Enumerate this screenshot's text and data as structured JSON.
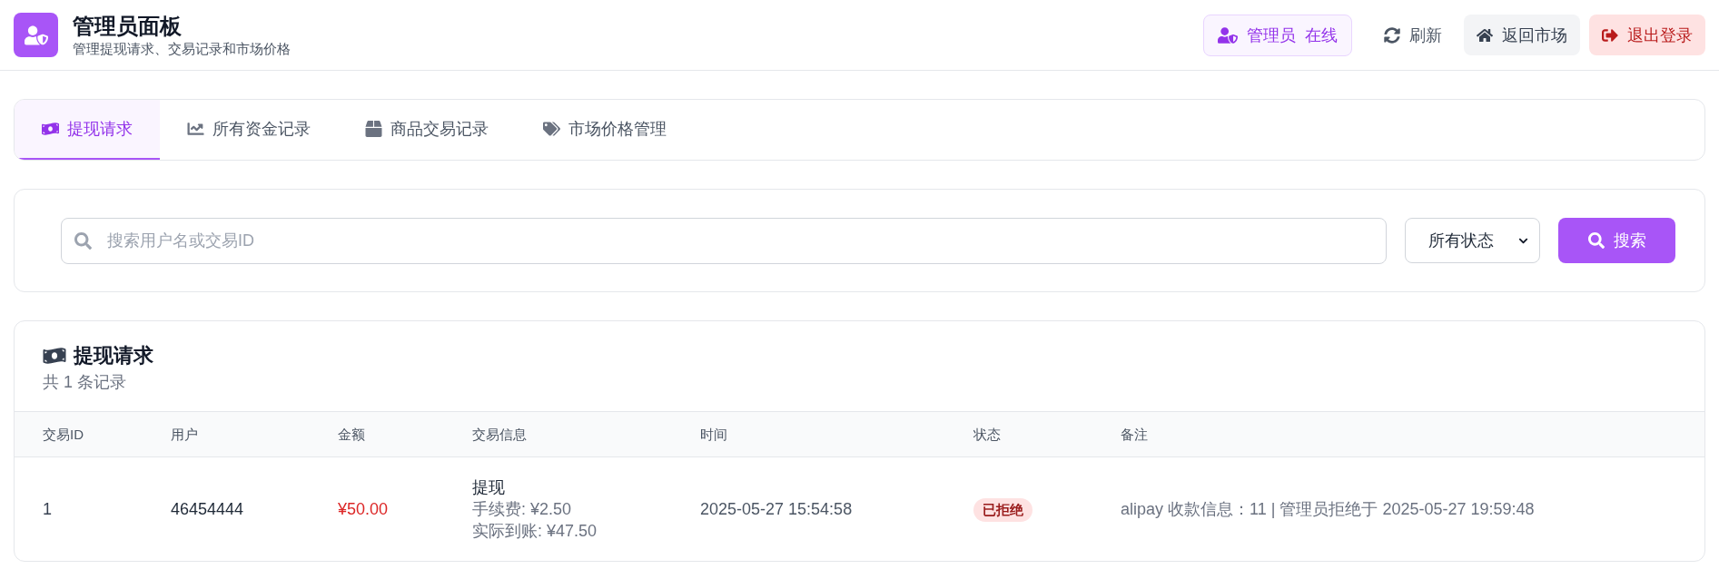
{
  "header": {
    "title": "管理员面板",
    "subtitle": "管理提现请求、交易记录和市场价格",
    "user_badge": {
      "role": "管理员",
      "status": "在线"
    },
    "buttons": [
      {
        "label": "刷新",
        "kind": "refresh"
      },
      {
        "label": "返回市场",
        "kind": "home"
      },
      {
        "label": "退出登录",
        "kind": "logout"
      }
    ]
  },
  "tabs": [
    {
      "label": "提现请求",
      "selected": true
    },
    {
      "label": "所有资金记录",
      "selected": false
    },
    {
      "label": "商品交易记录",
      "selected": false
    },
    {
      "label": "市场价格管理",
      "selected": false
    }
  ],
  "search": {
    "placeholder": "搜索用户名或交易ID",
    "status_filter": "所有状态",
    "button": "搜索"
  },
  "withdrawals": {
    "title": "提现请求",
    "count": "共 1 条记录",
    "columns": [
      "交易ID",
      "用户",
      "金额",
      "交易信息",
      "时间",
      "状态",
      "备注"
    ],
    "rows": [
      {
        "id": "1",
        "user": "46454444",
        "amount": "¥50.00",
        "info": {
          "type": "提现",
          "lines": [
            "手续费: ¥2.50",
            "实际到账: ¥47.50"
          ]
        },
        "time": "2025-05-27 15:54:58",
        "status": {
          "label": "已拒绝",
          "kind": "rejected"
        },
        "note": "alipay 收款信息：11 | 管理员拒绝于 2025-05-27 19:59:48"
      }
    ]
  }
}
